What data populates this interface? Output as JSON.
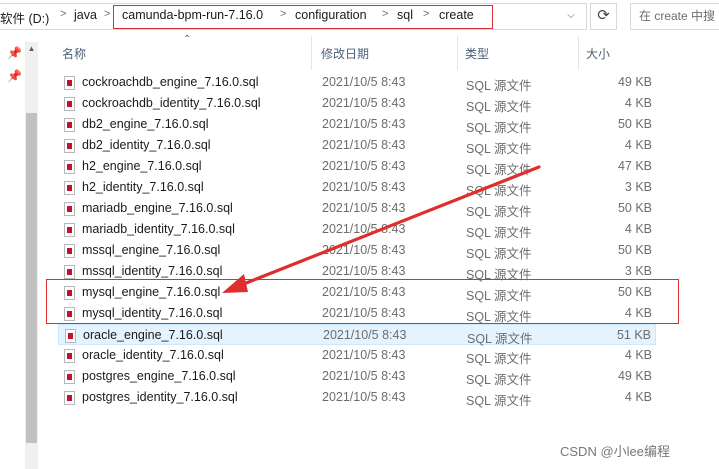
{
  "address": {
    "crumbs": [
      "软件 (D:)",
      "java",
      "camunda-bpm-run-7.16.0",
      "configuration",
      "sql",
      "create"
    ],
    "refresh_icon": "refresh-icon",
    "search_text": "在 create 中搜"
  },
  "columns": {
    "name": "名称",
    "date": "修改日期",
    "type": "类型",
    "size": "大小"
  },
  "files": [
    {
      "name": "cockroachdb_engine_7.16.0.sql",
      "date": "2021/10/5 8:43",
      "type": "SQL 源文件",
      "size": "49 KB"
    },
    {
      "name": "cockroachdb_identity_7.16.0.sql",
      "date": "2021/10/5 8:43",
      "type": "SQL 源文件",
      "size": "4 KB"
    },
    {
      "name": "db2_engine_7.16.0.sql",
      "date": "2021/10/5 8:43",
      "type": "SQL 源文件",
      "size": "50 KB"
    },
    {
      "name": "db2_identity_7.16.0.sql",
      "date": "2021/10/5 8:43",
      "type": "SQL 源文件",
      "size": "4 KB"
    },
    {
      "name": "h2_engine_7.16.0.sql",
      "date": "2021/10/5 8:43",
      "type": "SQL 源文件",
      "size": "47 KB"
    },
    {
      "name": "h2_identity_7.16.0.sql",
      "date": "2021/10/5 8:43",
      "type": "SQL 源文件",
      "size": "3 KB"
    },
    {
      "name": "mariadb_engine_7.16.0.sql",
      "date": "2021/10/5 8:43",
      "type": "SQL 源文件",
      "size": "50 KB"
    },
    {
      "name": "mariadb_identity_7.16.0.sql",
      "date": "2021/10/5 8:43",
      "type": "SQL 源文件",
      "size": "4 KB"
    },
    {
      "name": "mssql_engine_7.16.0.sql",
      "date": "2021/10/5 8:43",
      "type": "SQL 源文件",
      "size": "50 KB"
    },
    {
      "name": "mssql_identity_7.16.0.sql",
      "date": "2021/10/5 8:43",
      "type": "SQL 源文件",
      "size": "3 KB"
    },
    {
      "name": "mysql_engine_7.16.0.sql",
      "date": "2021/10/5 8:43",
      "type": "SQL 源文件",
      "size": "50 KB"
    },
    {
      "name": "mysql_identity_7.16.0.sql",
      "date": "2021/10/5 8:43",
      "type": "SQL 源文件",
      "size": "4 KB"
    },
    {
      "name": "oracle_engine_7.16.0.sql",
      "date": "2021/10/5 8:43",
      "type": "SQL 源文件",
      "size": "51 KB"
    },
    {
      "name": "oracle_identity_7.16.0.sql",
      "date": "2021/10/5 8:43",
      "type": "SQL 源文件",
      "size": "4 KB"
    },
    {
      "name": "postgres_engine_7.16.0.sql",
      "date": "2021/10/5 8:43",
      "type": "SQL 源文件",
      "size": "49 KB"
    },
    {
      "name": "postgres_identity_7.16.0.sql",
      "date": "2021/10/5 8:43",
      "type": "SQL 源文件",
      "size": "4 KB"
    }
  ],
  "selected_row": 12,
  "annotation_color": "#e02d2d",
  "watermark": "CSDN @小lee编程"
}
